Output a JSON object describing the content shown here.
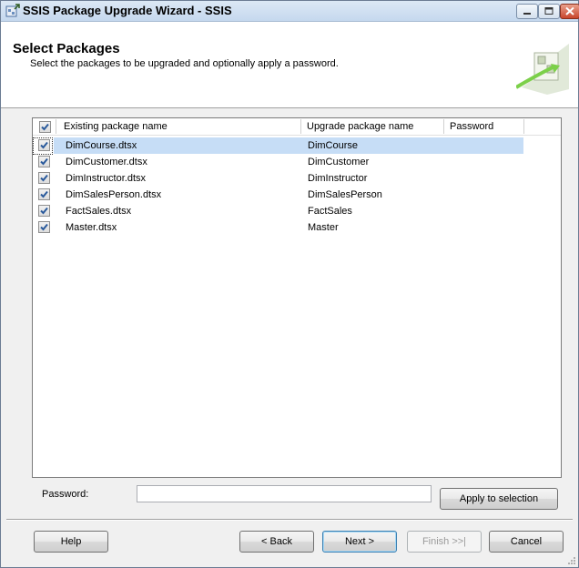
{
  "window": {
    "title": "SSIS Package Upgrade Wizard - SSIS"
  },
  "header": {
    "title": "Select Packages",
    "subtitle": "Select the packages to be upgraded and optionally apply a password."
  },
  "list": {
    "select_all_checked": true,
    "columns": [
      "Existing package name",
      "Upgrade package name",
      "Password"
    ],
    "rows": [
      {
        "checked": true,
        "existing": "DimCourse.dtsx",
        "upgrade": "DimCourse",
        "password": "",
        "selected": true
      },
      {
        "checked": true,
        "existing": "DimCustomer.dtsx",
        "upgrade": "DimCustomer",
        "password": ""
      },
      {
        "checked": true,
        "existing": "DimInstructor.dtsx",
        "upgrade": "DimInstructor",
        "password": ""
      },
      {
        "checked": true,
        "existing": "DimSalesPerson.dtsx",
        "upgrade": "DimSalesPerson",
        "password": ""
      },
      {
        "checked": true,
        "existing": "FactSales.dtsx",
        "upgrade": "FactSales",
        "password": ""
      },
      {
        "checked": true,
        "existing": "Master.dtsx",
        "upgrade": "Master",
        "password": ""
      }
    ]
  },
  "password": {
    "label": "Password:",
    "value": "",
    "apply_label": "Apply to selection"
  },
  "footer": {
    "help": "Help",
    "back": "< Back",
    "next": "Next >",
    "finish": "Finish >>|",
    "cancel": "Cancel"
  },
  "colors": {
    "selection": "#c6ddf6",
    "title_bar": "#c5d8ee",
    "close_button": "#c8462c"
  }
}
